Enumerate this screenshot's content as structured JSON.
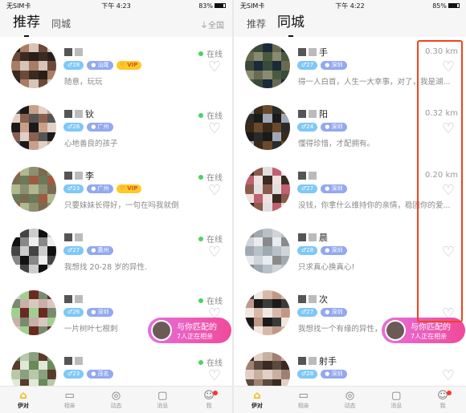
{
  "left": {
    "status": {
      "carrier": "无SIM卡",
      "time": "下午 4:23",
      "battery": "83%",
      "battery_level": 83
    },
    "tabs": [
      {
        "label": "推荐",
        "active": true
      },
      {
        "label": "同城",
        "active": false
      }
    ],
    "filter_label": "全国",
    "rows": [
      {
        "name": "",
        "age": "28",
        "city": "汕尾",
        "vip": "VIP",
        "bio": "随意，玩玩",
        "status": "在线"
      },
      {
        "name": "钬",
        "age": "28",
        "city": "广州",
        "vip": "",
        "bio": "心地善良的孩子",
        "status": "在线"
      },
      {
        "name": "李",
        "age": "23",
        "city": "广州",
        "vip": "VIP",
        "bio": "只要妹妹长得好，一句在吗我就倒",
        "status": "在线"
      },
      {
        "name": "",
        "age": "27",
        "city": "惠州",
        "vip": "",
        "bio": "我想找 20-28 岁的异性.",
        "status": "在线"
      },
      {
        "name": "",
        "age": "26",
        "city": "深圳",
        "vip": "",
        "bio": "一片树叶七根刺",
        "status": "在线"
      },
      {
        "name": "",
        "age": "23",
        "city": "茂名",
        "vip": "",
        "bio": "",
        "status": "在线"
      }
    ],
    "match": {
      "line1": "与你匹配的",
      "line2": "7人正在相亲"
    },
    "tabbar": [
      {
        "label": "伊对",
        "icon": "home-icon",
        "active": true
      },
      {
        "label": "相亲",
        "icon": "video-icon"
      },
      {
        "label": "动态",
        "icon": "compass-icon"
      },
      {
        "label": "消息",
        "icon": "chat-icon"
      },
      {
        "label": "我",
        "icon": "profile-icon",
        "badge": true
      }
    ]
  },
  "right": {
    "status": {
      "carrier": "无SIM卡",
      "time": "下午 4:22",
      "battery": "85%",
      "battery_level": 85
    },
    "tabs": [
      {
        "label": "推荐",
        "active": false
      },
      {
        "label": "同城",
        "active": true
      }
    ],
    "rows": [
      {
        "name": "手",
        "age": "27",
        "city": "深圳",
        "bio": "得一人白首，人生一大幸事，对了，我是湖...",
        "distance": "0.30 km"
      },
      {
        "name": "阳",
        "age": "24",
        "city": "深圳",
        "bio": "懂得珍惜，才配拥有。",
        "distance": "0.32 km"
      },
      {
        "name": "",
        "age": "27",
        "city": "深圳",
        "bio": "没钱，你拿什么维持你的亲情，稳固你的爱...",
        "distance": "0.20 km"
      },
      {
        "name": "晨",
        "age": "28",
        "city": "深圳",
        "bio": "只求真心换真心!",
        "distance": ""
      },
      {
        "name": "次",
        "age": "27",
        "city": "深圳",
        "bio": "我想找一个有缘的异性，",
        "distance": ""
      },
      {
        "name": "射手",
        "age": "28",
        "city": "深圳",
        "bio": "",
        "distance": ""
      }
    ],
    "match": {
      "line1": "与你匹配的",
      "line2": "7人正在相亲"
    },
    "tabbar": [
      {
        "label": "伊对",
        "icon": "home-icon",
        "active": true
      },
      {
        "label": "相亲",
        "icon": "video-icon"
      },
      {
        "label": "动态",
        "icon": "compass-icon"
      },
      {
        "label": "消息",
        "icon": "chat-icon"
      },
      {
        "label": "我",
        "icon": "profile-icon",
        "badge": true
      }
    ]
  },
  "colors": {
    "accent": "#f0b800",
    "online": "#4cd164",
    "highlight": "#f0431e",
    "age_tag": "#7ec8f7",
    "city_tag": "#93a8f0",
    "vip_tag": "#ffc928"
  }
}
